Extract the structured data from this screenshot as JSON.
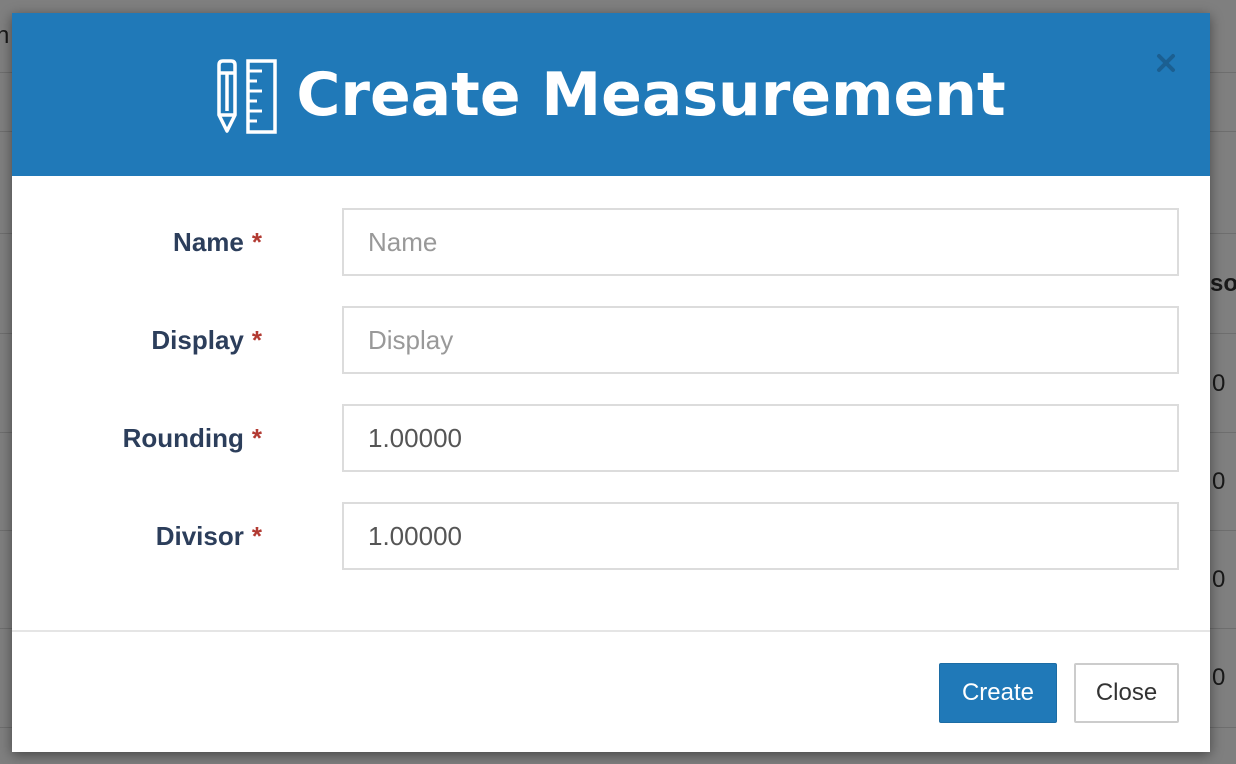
{
  "background": {
    "fragments": [
      "n",
      "so",
      "0",
      "0",
      "0",
      "0"
    ]
  },
  "modal": {
    "title": "Create Measurement",
    "icon": "pencil-ruler-icon",
    "close_icon": "close-icon"
  },
  "form": {
    "fields": [
      {
        "label": "Name",
        "required_mark": "*",
        "value": "",
        "placeholder": "Name"
      },
      {
        "label": "Display",
        "required_mark": "*",
        "value": "",
        "placeholder": "Display"
      },
      {
        "label": "Rounding",
        "required_mark": "*",
        "value": "1.00000",
        "placeholder": ""
      },
      {
        "label": "Divisor",
        "required_mark": "*",
        "value": "1.00000",
        "placeholder": ""
      }
    ]
  },
  "footer": {
    "create_label": "Create",
    "close_label": "Close"
  },
  "colors": {
    "header": "#2079b8",
    "primary_button": "#2079b8",
    "label_text": "#2c3e5b",
    "required": "#b23a32"
  }
}
